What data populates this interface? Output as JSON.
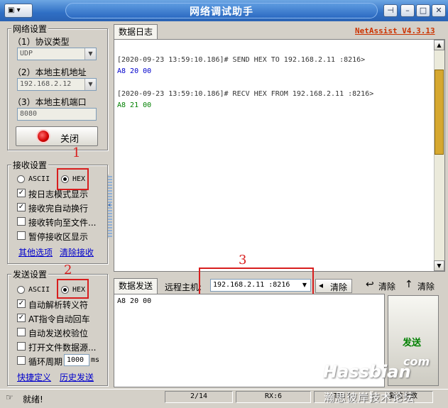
{
  "window": {
    "title": "网络调试助手",
    "brand": "NetAssist V4.3.13"
  },
  "net_settings": {
    "title": "网络设置",
    "protocol_label": "（1）协议类型",
    "protocol_value": "UDP",
    "host_label": "（2）本地主机地址",
    "host_value": "192.168.2.12",
    "port_label": "（3）本地主机端口",
    "port_value": "8080",
    "close_label": "关闭"
  },
  "recv_settings": {
    "title": "接收设置",
    "ascii": "ASCII",
    "hex": "HEX",
    "opt_log": "按日志模式显示",
    "opt_wrap": "接收完自动换行",
    "opt_file": "接收转向至文件...",
    "opt_pause": "暂停接收区显示",
    "link_more": "其他选项",
    "link_clear": "清除接收"
  },
  "send_settings": {
    "title": "发送设置",
    "ascii": "ASCII",
    "hex": "HEX",
    "opt_escape": "自动解析转义符",
    "opt_at": "AT指令自动回车",
    "opt_checksum": "自动发送校验位",
    "opt_file": "打开文件数据源...",
    "opt_loop": "循环周期",
    "loop_value": "1000",
    "loop_unit": "ms",
    "link_shortcut": "快捷定义",
    "link_history": "历史发送"
  },
  "log": {
    "tab": "数据日志",
    "lines": [
      {
        "text": "[2020-09-23 13:59:10.186]# SEND HEX TO 192.168.2.11 :8216>",
        "color": "#333333"
      },
      {
        "text": "A8 20 00",
        "color": "#0000cc"
      },
      {
        "text": "[2020-09-23 13:59:10.186]# RECV HEX FROM 192.168.2.11 :8216>",
        "color": "#333333"
      },
      {
        "text": "A8 21 00",
        "color": "#008000"
      }
    ]
  },
  "send_bar": {
    "tab": "数据发送",
    "remote_label": "远程主机:",
    "remote_value": "192.168.2.11 :8216",
    "clear1": "清除",
    "clear2": "清除",
    "clear3": "清除",
    "send_text": "A8 20 00",
    "send_button": "发送"
  },
  "status": {
    "ready": "就绪!",
    "count": "2/14",
    "rx": "RX:6",
    "tx": "TX:3",
    "reset": "复位计数"
  },
  "annotations": {
    "one": "1",
    "two": "2",
    "three": "3"
  },
  "watermark": {
    "brand": "Hassbian",
    "com": "com",
    "forum": "瀚思彼岸技术论坛"
  }
}
